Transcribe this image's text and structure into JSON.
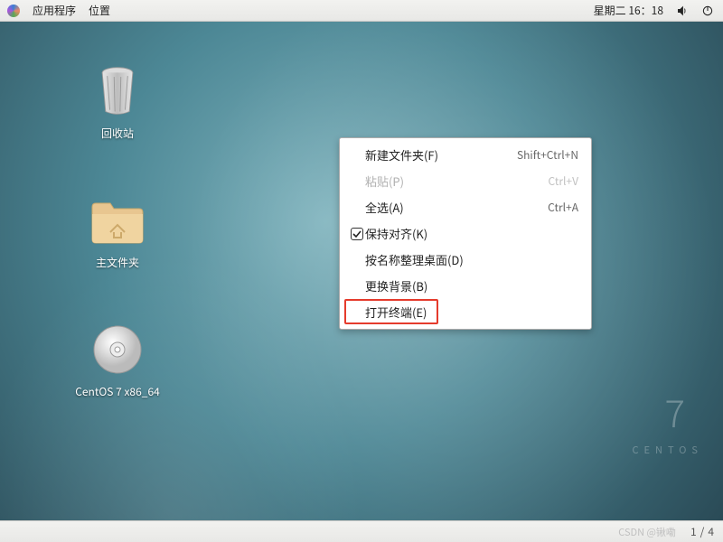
{
  "top_panel": {
    "apps_label": "应用程序",
    "places_label": "位置",
    "clock": "星期二 16：18"
  },
  "desktop_icons": {
    "trash_label": "回收站",
    "home_label": "主文件夹",
    "disc_label": "CentOS 7 x86_64"
  },
  "context_menu": {
    "new_folder": {
      "label": "新建文件夹(F)",
      "shortcut": "Shift+Ctrl+N"
    },
    "paste": {
      "label": "粘贴(P)",
      "shortcut": "Ctrl+V"
    },
    "select_all": {
      "label": "全选(A)",
      "shortcut": "Ctrl+A"
    },
    "keep_aligned": {
      "label": "保持对齐(K)"
    },
    "organize": {
      "label": "按名称整理桌面(D)"
    },
    "change_bg": {
      "label": "更换背景(B)"
    },
    "open_terminal": {
      "label": "打开终端(E)"
    }
  },
  "branding": {
    "seven": "7",
    "centos": "CENTOS"
  },
  "bottom_panel": {
    "watermark": "CSDN @锹嘞",
    "ws_current": "1",
    "ws_sep": "/",
    "ws_total": "4"
  }
}
